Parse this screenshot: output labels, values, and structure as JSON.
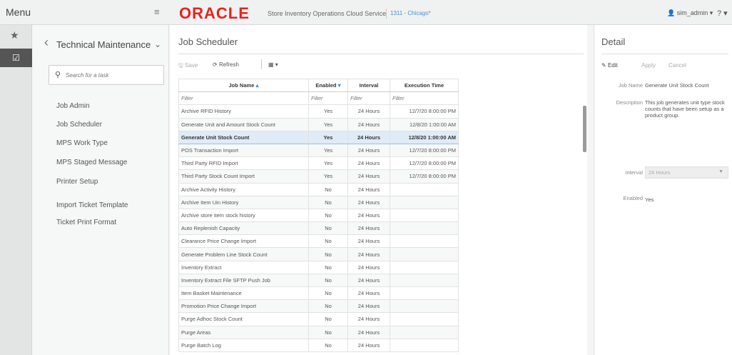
{
  "header": {
    "menu_title": "Menu",
    "logo": "ORACLE",
    "app_name": "Store Inventory Operations Cloud Service",
    "store": "1311 - Chicago*",
    "user": "sim_admin ▾",
    "help": "? ▾"
  },
  "rail": {
    "favorites_icon": "star-icon",
    "tasks_icon": "task-icon"
  },
  "nav": {
    "title": "Technical Maintenance",
    "search_placeholder": "Search for a task",
    "items": [
      {
        "label": "Job Admin"
      },
      {
        "label": "Job Scheduler"
      },
      {
        "label": "MPS Work Type"
      },
      {
        "label": "MPS Staged Message"
      },
      {
        "label": "Printer Setup"
      },
      {
        "label": "Import Ticket Template"
      },
      {
        "label": "Ticket Print Format"
      }
    ]
  },
  "main": {
    "title": "Job Scheduler",
    "toolbar": {
      "save": "Save",
      "refresh": "Refresh"
    },
    "columns": [
      "Job Name",
      "Enabled",
      "Interval",
      "Execution Time"
    ],
    "filter_placeholder": "Filter",
    "rows": [
      {
        "name": "Archive RFID History",
        "enabled": "Yes",
        "interval": "24 Hours",
        "time": "12/7/20 8:00:00 PM"
      },
      {
        "name": "Generate Unit and Amount Stock Count",
        "enabled": "Yes",
        "interval": "24 Hours",
        "time": "12/8/20 1:00:00 AM"
      },
      {
        "name": "Generate Unit Stock Count",
        "enabled": "Yes",
        "interval": "24 Hours",
        "time": "12/8/20 1:00:00 AM"
      },
      {
        "name": "POS Transaction Import",
        "enabled": "Yes",
        "interval": "24 Hours",
        "time": "12/7/20 8:00:00 PM"
      },
      {
        "name": "Third Party RFID Import",
        "enabled": "Yes",
        "interval": "24 Hours",
        "time": "12/7/20 8:00:00 PM"
      },
      {
        "name": "Third Party Stock Count Import",
        "enabled": "Yes",
        "interval": "24 Hours",
        "time": "12/7/20 8:00:00 PM"
      },
      {
        "name": "Archive Activity History",
        "enabled": "No",
        "interval": "24 Hours",
        "time": ""
      },
      {
        "name": "Archive Item Uin History",
        "enabled": "No",
        "interval": "24 Hours",
        "time": ""
      },
      {
        "name": "Archive store item stock history",
        "enabled": "No",
        "interval": "24 Hours",
        "time": ""
      },
      {
        "name": "Auto Replenish Capacity",
        "enabled": "No",
        "interval": "24 Hours",
        "time": ""
      },
      {
        "name": "Clearance Price Change Import",
        "enabled": "No",
        "interval": "24 Hours",
        "time": ""
      },
      {
        "name": "Generate Problem Line Stock Count",
        "enabled": "No",
        "interval": "24 Hours",
        "time": ""
      },
      {
        "name": "Inventory Extract",
        "enabled": "No",
        "interval": "24 Hours",
        "time": ""
      },
      {
        "name": "Inventory Extract File SFTP Push Job",
        "enabled": "No",
        "interval": "24 Hours",
        "time": ""
      },
      {
        "name": "Item Basket Maintenance",
        "enabled": "No",
        "interval": "24 Hours",
        "time": ""
      },
      {
        "name": "Promotion Price Change Import",
        "enabled": "No",
        "interval": "24 Hours",
        "time": ""
      },
      {
        "name": "Purge Adhoc Stock Count",
        "enabled": "No",
        "interval": "24 Hours",
        "time": ""
      },
      {
        "name": "Purge Areas",
        "enabled": "No",
        "interval": "24 Hours",
        "time": ""
      },
      {
        "name": "Purge Batch Log",
        "enabled": "No",
        "interval": "24 Hours",
        "time": ""
      }
    ],
    "selected_row": 2
  },
  "detail": {
    "title": "Detail",
    "actions": {
      "edit": "Edit",
      "apply": "Apply",
      "cancel": "Cancel"
    },
    "job_name_label": "Job Name",
    "job_name": "Generate Unit Stock Count",
    "description_label": "Description",
    "description": "This job generates unit type stock counts that have been setup as a product group.",
    "interval_label": "Interval",
    "interval": "24 Hours",
    "enabled_label": "Enabled",
    "enabled": "Yes"
  },
  "colors": {
    "brand": "#e8231e",
    "accent": "#4a90c8",
    "selected_row": "#dfebf6"
  }
}
